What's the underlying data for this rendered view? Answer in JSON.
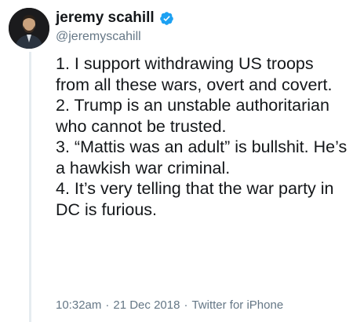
{
  "author": {
    "display_name": "jeremy scahill",
    "handle": "@jeremyscahill",
    "verified": true,
    "verified_color": "#1da1f2"
  },
  "tweet": {
    "lines": [
      "1. I support withdrawing US troops from all these wars, overt and covert.",
      "2. Trump is an unstable authoritarian who cannot be trusted.",
      "3. “Mattis was an adult” is bullshit. He’s a hawkish war criminal.",
      "4. It’s very telling that the war party in DC is furious."
    ]
  },
  "meta": {
    "time": "10:32am",
    "separator": "·",
    "date": "21 Dec 2018",
    "source": "Twitter for iPhone"
  },
  "icons": {
    "avatar": "profile-photo",
    "verified": "verified-badge-icon"
  }
}
